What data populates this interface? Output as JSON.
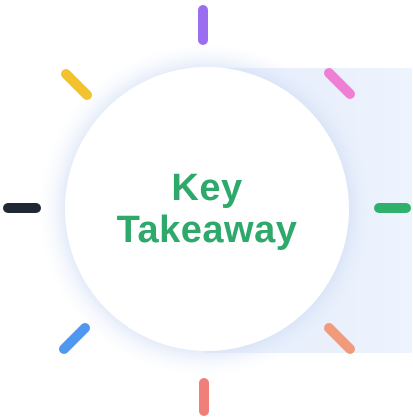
{
  "card": {
    "title_line1": "Key",
    "title_line2": "Takeaway",
    "title_color": "#2fa96b"
  },
  "ticks": [
    {
      "icon": "tick-top",
      "color": "#9b6df0"
    },
    {
      "icon": "tick-top-right",
      "color": "#ef7fd3"
    },
    {
      "icon": "tick-right",
      "color": "#2fb06b"
    },
    {
      "icon": "tick-bottom-right",
      "color": "#f19b7c"
    },
    {
      "icon": "tick-bottom",
      "color": "#f07f7a"
    },
    {
      "icon": "tick-bottom-left",
      "color": "#4f97ef"
    },
    {
      "icon": "tick-left",
      "color": "#1f2833"
    },
    {
      "icon": "tick-top-left",
      "color": "#f3c32f"
    }
  ]
}
